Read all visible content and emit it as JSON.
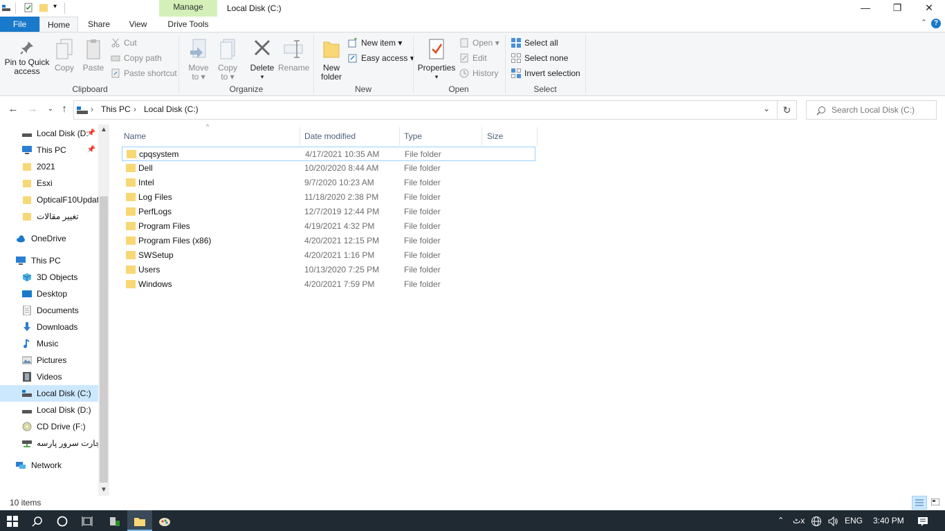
{
  "window": {
    "title": "Local Disk (C:)",
    "context_tab": "Manage",
    "minimize": "—",
    "restore": "❐",
    "close": "✕"
  },
  "tabs": {
    "file": "File",
    "home": "Home",
    "share": "Share",
    "view": "View",
    "drive_tools": "Drive Tools"
  },
  "ribbon": {
    "clipboard": {
      "label": "Clipboard",
      "pin_line1": "Pin to Quick",
      "pin_line2": "access",
      "copy": "Copy",
      "paste": "Paste",
      "cut": "Cut",
      "copy_path": "Copy path",
      "paste_shortcut": "Paste shortcut"
    },
    "organize": {
      "label": "Organize",
      "move_line1": "Move",
      "move_line2": "to ▾",
      "copy_line1": "Copy",
      "copy_line2": "to ▾",
      "delete": "Delete",
      "delete_arrow": "▾",
      "rename": "Rename"
    },
    "new": {
      "label": "New",
      "folder_line1": "New",
      "folder_line2": "folder",
      "new_item": "New item ▾",
      "easy_access": "Easy access ▾"
    },
    "open": {
      "label": "Open",
      "properties": "Properties",
      "properties_arrow": "▾",
      "open": "Open ▾",
      "edit": "Edit",
      "history": "History"
    },
    "select": {
      "label": "Select",
      "select_all": "Select all",
      "select_none": "Select none",
      "invert": "Invert selection"
    }
  },
  "address": {
    "crumbs": [
      "This PC",
      "Local Disk (C:)"
    ],
    "search_placeholder": "Search Local Disk (C:)"
  },
  "nav": {
    "quick": [
      {
        "label": "Local Disk (D:",
        "pinned": true
      },
      {
        "label": "This PC",
        "pinned": true
      },
      {
        "label": "2021"
      },
      {
        "label": "Esxi"
      },
      {
        "label": "OpticalF10Updat"
      },
      {
        "label": "تغییر مقالات"
      }
    ],
    "onedrive": "OneDrive",
    "this_pc": "This PC",
    "pc_items": [
      "3D Objects",
      "Desktop",
      "Documents",
      "Downloads",
      "Music",
      "Pictures",
      "Videos",
      "Local Disk (C:)",
      "Local Disk (D:)",
      "CD Drive (F:)",
      "تجارت سرور پارسه"
    ],
    "network": "Network"
  },
  "columns": {
    "name": "Name",
    "date": "Date modified",
    "type": "Type",
    "size": "Size"
  },
  "files": [
    {
      "name": "cpqsystem",
      "date": "4/17/2021 10:35 AM",
      "type": "File folder"
    },
    {
      "name": "Dell",
      "date": "10/20/2020 8:44 AM",
      "type": "File folder"
    },
    {
      "name": "Intel",
      "date": "9/7/2020 10:23 AM",
      "type": "File folder"
    },
    {
      "name": "Log Files",
      "date": "11/18/2020 2:38 PM",
      "type": "File folder"
    },
    {
      "name": "PerfLogs",
      "date": "12/7/2019 12:44 PM",
      "type": "File folder"
    },
    {
      "name": "Program Files",
      "date": "4/19/2021 4:32 PM",
      "type": "File folder"
    },
    {
      "name": "Program Files (x86)",
      "date": "4/20/2021 12:15 PM",
      "type": "File folder"
    },
    {
      "name": "SWSetup",
      "date": "4/20/2021 1:16 PM",
      "type": "File folder"
    },
    {
      "name": "Users",
      "date": "10/13/2020 7:25 PM",
      "type": "File folder"
    },
    {
      "name": "Windows",
      "date": "4/20/2021 7:59 PM",
      "type": "File folder"
    }
  ],
  "status": {
    "items": "10 items"
  },
  "taskbar": {
    "language": "ENG",
    "time": "3:40 PM",
    "lang_indicator": "ٹx"
  },
  "colors": {
    "accent": "#1979ca",
    "manage_tab": "#d4f0b8",
    "selection": "#cce8ff",
    "folder": "#f8d775",
    "taskbar": "#202a33"
  }
}
